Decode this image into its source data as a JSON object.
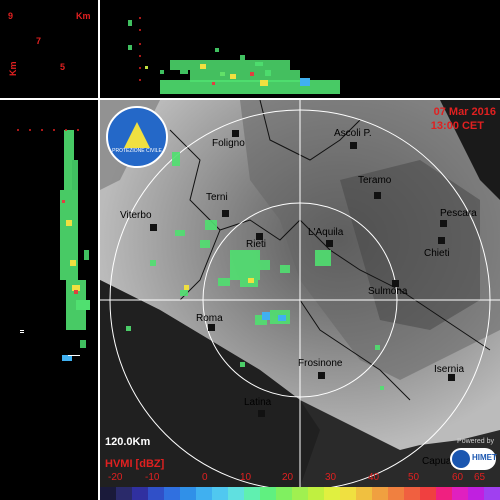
{
  "header": {
    "date": "07 Mar 2016",
    "time": "13:00 CET"
  },
  "logo": {
    "text": "PROTEZIONE CIVILE"
  },
  "height_axis": {
    "unit_top": "Km",
    "unit_left": "Km",
    "ticks_top": [
      "9",
      "7",
      "5"
    ]
  },
  "map": {
    "range_label": "120.0Km",
    "cities": [
      {
        "name": "Foligno"
      },
      {
        "name": "Ascoli P."
      },
      {
        "name": "Teramo"
      },
      {
        "name": "Terni"
      },
      {
        "name": "Pescara"
      },
      {
        "name": "Viterbo"
      },
      {
        "name": "L'Aquila"
      },
      {
        "name": "Chieti"
      },
      {
        "name": "Rieti"
      },
      {
        "name": "Sulmona"
      },
      {
        "name": "Roma"
      },
      {
        "name": "Frosinone"
      },
      {
        "name": "Isernia"
      },
      {
        "name": "Latina"
      },
      {
        "name": "Capua"
      }
    ]
  },
  "product": {
    "label": "HVMI [dBZ]"
  },
  "brand": {
    "powered": "Powered by",
    "name": "HIMET"
  },
  "colorscale": {
    "ticks": [
      "-20",
      "-10",
      "0",
      "10",
      "20",
      "30",
      "40",
      "50",
      "60",
      "65"
    ],
    "colors": [
      "#1a1a3a",
      "#2a2a6a",
      "#3030a0",
      "#3050c8",
      "#3070e0",
      "#3090e8",
      "#40b0f0",
      "#50c8f0",
      "#60e0e0",
      "#60f0b0",
      "#60f080",
      "#80f060",
      "#a0f050",
      "#c0f040",
      "#e0f040",
      "#f0e040",
      "#f0c040",
      "#f0a040",
      "#f08040",
      "#f06040",
      "#f04040",
      "#f02080",
      "#e020c0",
      "#c020e0",
      "#a040f0"
    ]
  }
}
